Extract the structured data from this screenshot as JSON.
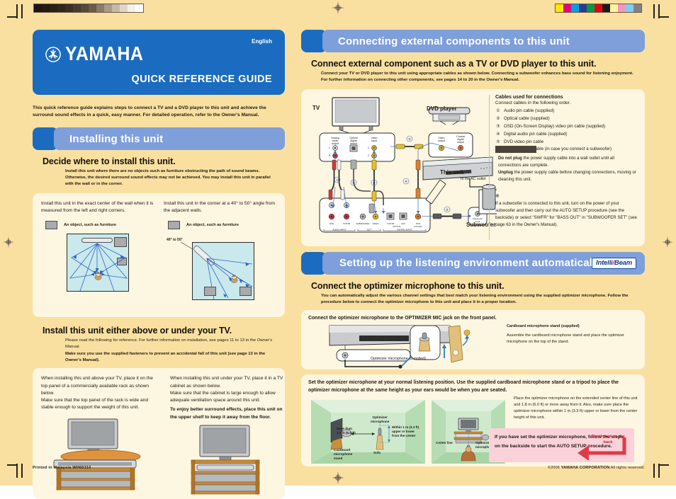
{
  "meta": {
    "language_label": "English",
    "brand": "YAMAHA",
    "doc_title": "QUICK REFERENCE GUIDE",
    "intro": "This quick reference guide explains steps to connect a TV and a DVD player to this unit and achieve the surround sound effects in a quick, easy manner. For detailed operation, refer to the Owner's Manual.",
    "footer_left": "Printed in Malaysia    WH66310",
    "footer_left_cmark": "c",
    "footer_right_prefix": "©2006 ",
    "footer_right_brand": "YAMAHA CORPORATION",
    "footer_right_suffix": " All rights reserved."
  },
  "registration": {
    "grayscale_steps": [
      "#1c1613",
      "#221a16",
      "#29201a",
      "#2f2620",
      "#3a2f27",
      "#473b31",
      "#55483c",
      "#6a5b4d",
      "#8a7b6c",
      "#a89b8d",
      "#c4b9ad",
      "#ded6cd",
      "#f4f1ec",
      "#ffffff"
    ],
    "color_patches": [
      "#ffe800",
      "#e5007f",
      "#00a0e9",
      "#2b3990",
      "#009944",
      "#e60012",
      "#1a1a1a",
      "#fff3a0",
      "#f497c0",
      "#7ecef4",
      "#808285"
    ]
  },
  "section1": {
    "number_tab": "",
    "title": "Installing this unit",
    "heading": "Decide where to install this unit.",
    "lead": "Install this unit where there are no objects such as furniture obstructing the path of sound beams. Otherwise, the desired surround sound effects may not be achieved. You may install this unit in parallel with the wall or in the corner.",
    "left_case": {
      "text": "Install this unit in the exact center of the wall when it is measured from the left and right corners.",
      "legend": "An object, such as furniture"
    },
    "right_case": {
      "text": "Install this unit in the corner at a 40° to 50° angle from the adjacent walls.",
      "legend": "An object, such as furniture",
      "angle_label": "40° to 50°"
    },
    "heading2": "Install this unit either above or under your TV.",
    "lead2_line1": "Please read the following for reference. For further information on installation, see pages 11 to 13 in the Owner's Manual.",
    "lead2_line2": "Make sure you use the supplied fasteners to prevent an accidental fall of this unit (see page 13 in the Owner's Manual).",
    "above_text": "When installing this unit above your TV, place it on the top panel of a commercially available rack as shown below.\nMake sure that the top panel of the rack is wide and stable enough to support the weight of this unit.",
    "under_text": "When installing this unit under your TV, place it in a TV cabinet as shown below.\nMake sure that the cabinet is large enough to allow adequate ventilation space around this unit.",
    "under_text_bold": "To enjoy better surround effects, place this unit on the upper shelf to keep it away from the floor."
  },
  "section2": {
    "title": "Connecting external components to this unit",
    "heading": "Connect external component such as a TV or DVD player to this unit.",
    "lead": "Connect your TV or DVD player to this unit using appropriate cables as shown below.  Connecting a subwoofer enhances bass sound for listening enjoyment. For further information on connecting other components, see pages 14 to 20 in the Owner's Manual.",
    "diagram_labels": {
      "tv": "TV",
      "dvd": "DVD player",
      "this_unit": "This unit",
      "subwoofer": "Subwoofer",
      "ac_outlet": "To the AC outlet",
      "tv_analog_audio": "Analog\naudio\noutput",
      "tv_optical": "Optical\ndigital\noutput",
      "tv_video_in": "Video\ninput",
      "dvd_video_out": "Video\noutput",
      "dvd_coaxial": "Coaxial\ndigital\noutput",
      "sub_input": "Subwoofer\ninput",
      "unit_audio_input": "AUDIO INPUT",
      "unit_out": "OUT",
      "unit_digital_input": "DIGITAL INPUT",
      "jack_dvd": "DVD",
      "jack_tvstb": "TV/STB",
      "jack_subwoofer": "SUBWOOFER",
      "jack_video": "VIDEO",
      "jack_tvstb2": "TV/STB",
      "jack_aux": "AUX",
      "jack_dvd2": "DVD",
      "jack_optical": "OPTICAL",
      "jack_coaxial": "COAXIAL"
    },
    "cables_title": "Cables used for connections",
    "cables_sub": "Connect cables in the following order.",
    "cables": [
      {
        "n": "①",
        "text": "Audio pin cable (supplied)"
      },
      {
        "n": "②",
        "text": "Optical cable (supplied)"
      },
      {
        "n": "③",
        "text": "OSD (On-Screen Display) video pin cable (supplied)"
      },
      {
        "n": "④",
        "text": "Digital audio pin cable (supplied)"
      },
      {
        "n": "⑤",
        "text": "DVD video pin cable"
      },
      {
        "n": "⑥",
        "text": "Subwoofer pin cable (in case you connect a subwoofer)"
      }
    ],
    "caution_b1": "Do not plug",
    "caution_t1": " the power supply cable into a wall outlet until all connections are complete.",
    "caution_b2": "Unplug",
    "caution_t2": " the power supply cable before changing connections, moving or cleaning this unit.",
    "note_star": "※",
    "note_text": "If a subwoofer is connected to this unit, turn on the power of your subwoofer and then carry out the AUTO SETUP procedure (see the backside) or select \"SWFR\" for \"BASS OUT\" in \"SUBWOOFER SET\" (see page 63 in the Owner's Manual)."
  },
  "section3": {
    "title": "Setting up the listening environment automatically",
    "badge_pre": "Intelli",
    "badge_slash": "",
    "badge_post": "Beam",
    "heading": "Connect the optimizer microphone to this unit.",
    "lead": "You can automatically adjust the various channel settings that best match your listening environment using the supplied optimizer microphone. Follow the procedure below to connect the optimizer microphone to this unit and place it in a proper location.",
    "step1": "Connect the optimizer microphone to the OPTIMIZER MIC jack on the front panel.",
    "mic_supplied_label": "Optimizer microphone (supplied)",
    "stand_label": "Cardboard microphone stand (supplied)",
    "stand_text": "Assemble the cardboard microphone stand and place the optimizer microphone on the top of the stand.",
    "step2": "Set the optimizer microphone at your normal listening position. Use the supplied cardboard microphone stand or a tripod to place the optimizer microphone at the same height as your ears would be when you are seated.",
    "room_labels": {
      "optimizer_mic": "Optimizer\nmicrophone",
      "more_than": "More than\n1.8 m (6.0 ft)",
      "within": "Within 1 m (3.3 ft)\nupper or lower\nfrom the center",
      "cardboard_stand": "Cardboard\nmicrophone\nstand",
      "sofa": "Sofa",
      "center_line": "Center line",
      "optimizer_mic2": "Optimizer\nmicrophone"
    },
    "placement_note": "Place the optimizer microphone on the extended center line of this unit and 1.8 m (6.0 ft) or more away from it. Also, make sure place the optimizer microphone within 1 m (3.3 ft) upper or lower from the center height of this unit.",
    "cta_text": "If you have set the optimizer microphone, follow the steps on the backside to start the AUTO SETUP procedure.",
    "cta_badge": "Continued\non the back"
  }
}
